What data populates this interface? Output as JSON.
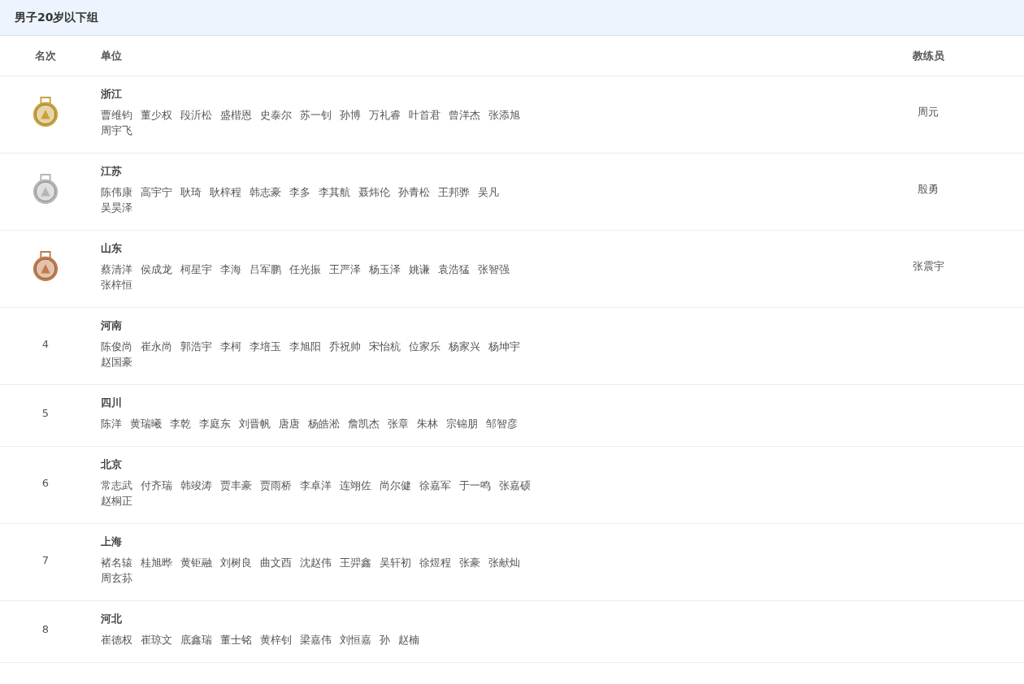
{
  "title": "男子20岁以下组",
  "columns": {
    "rank": "名次",
    "unit": "单位",
    "coach": "教练员"
  },
  "rows": [
    {
      "kind": "medal",
      "color": "#c9a13c",
      "team": "浙江",
      "members": [
        "曹维钧",
        "董少权",
        "段沂松",
        "盛楷恩",
        "史泰尔",
        "苏一钊",
        "孙博",
        "万礼睿",
        "叶首君",
        "曾洋杰",
        "张添旭",
        "周宇飞"
      ],
      "coach": "周元"
    },
    {
      "kind": "medal",
      "color": "#b5b5b5",
      "team": "江苏",
      "members": [
        "陈伟康",
        "高宇宁",
        "耿琦",
        "耿梓程",
        "韩志豪",
        "李多",
        "李其航",
        "聂炜伦",
        "孙青松",
        "王邦骅",
        "吴凡",
        "吴昊泽"
      ],
      "coach": "殷勇"
    },
    {
      "kind": "medal",
      "color": "#c07a4c",
      "team": "山东",
      "members": [
        "蔡清洋",
        "侯成龙",
        "柯星宇",
        "李海",
        "吕军鹏",
        "任光振",
        "王严泽",
        "杨玉泽",
        "姚谦",
        "袁浩猛",
        "张智强",
        "张梓恒"
      ],
      "coach": "张震宇"
    },
    {
      "kind": "rank",
      "rank": "4",
      "team": "河南",
      "members": [
        "陈俊尚",
        "崔永尚",
        "郭浩宇",
        "李柯",
        "李培玉",
        "李旭阳",
        "乔祝帅",
        "宋怡杭",
        "位家乐",
        "杨家兴",
        "杨坤宇",
        "赵国豪"
      ]
    },
    {
      "kind": "rank",
      "rank": "5",
      "team": "四川",
      "members": [
        "陈洋",
        "黄瑞曦",
        "李乾",
        "李庭东",
        "刘晋帆",
        "唐唐",
        "杨皓淞",
        "詹凯杰",
        "张章",
        "朱林",
        "宗锦朋",
        "邹智彦"
      ]
    },
    {
      "kind": "rank",
      "rank": "6",
      "team": "北京",
      "members": [
        "常志武",
        "付齐瑞",
        "韩竣涛",
        "贾丰豪",
        "贾雨桥",
        "李卓洋",
        "连翊佐",
        "尚尔健",
        "徐嘉军",
        "于一鸣",
        "张嘉硕",
        "赵桐正"
      ]
    },
    {
      "kind": "rank",
      "rank": "7",
      "team": "上海",
      "members": [
        "褚名辕",
        "桂旭晔",
        "黄钜融",
        "刘树良",
        "曲文酉",
        "沈赵伟",
        "王羿鑫",
        "吴轩初",
        "徐煜程",
        "张豪",
        "张献灿",
        "周玄荪"
      ]
    },
    {
      "kind": "rank",
      "rank": "8",
      "team": "河北",
      "members": [
        "崔德权",
        "崔琼文",
        "底鑫瑞",
        "董士铭",
        "黄梓钊",
        "梁嘉伟",
        "刘恒嘉",
        "孙",
        "赵楠"
      ]
    }
  ]
}
